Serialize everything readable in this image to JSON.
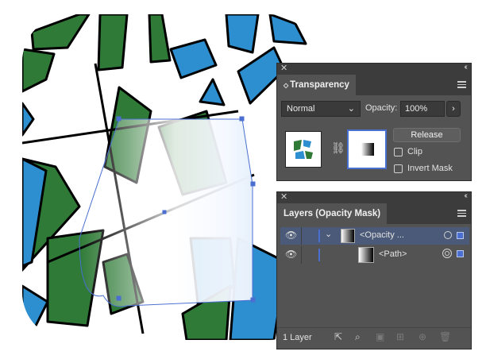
{
  "transparency": {
    "tab_title": "Transparency",
    "blend_mode": "Normal",
    "opacity_label": "Opacity:",
    "opacity_value": "100%",
    "release_label": "Release",
    "clip_label": "Clip",
    "invert_mask_label": "Invert Mask"
  },
  "layers": {
    "tab_title": "Layers (Opacity Mask)",
    "rows": [
      {
        "label": "<Opacity ..."
      },
      {
        "label": "<Path>"
      }
    ],
    "status": "1 Layer"
  },
  "colors": {
    "panel_bg": "#535353",
    "panel_dark": "#3c3c3c",
    "selection_blue": "#4a6fd1",
    "art_green": "#2f7a37",
    "art_blue": "#2d8fd0"
  },
  "icons": {
    "close": "close-icon",
    "collapse": "double-chevron-icon",
    "menu": "hamburger-menu-icon",
    "chain": "link-chain-icon",
    "eye": "eye-icon",
    "expand": "chevron-down-icon",
    "target": "target-circle-icon"
  }
}
